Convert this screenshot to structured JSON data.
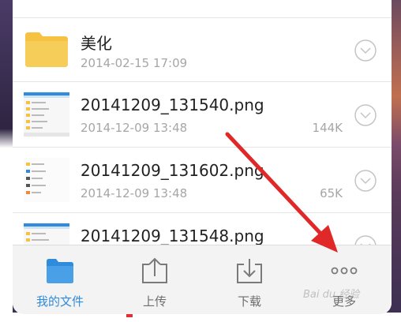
{
  "files": [
    {
      "name": "美化",
      "date": "2014-02-15 17:09",
      "size": "",
      "kind": "folder",
      "icon": "folder-icon"
    },
    {
      "name": "20141209_131540.png",
      "date": "2014-12-09 13:48",
      "size": "144K",
      "kind": "image",
      "icon": "image-thumbnail"
    },
    {
      "name": "20141209_131602.png",
      "date": "2014-12-09 13:48",
      "size": "65K",
      "kind": "image",
      "icon": "image-thumbnail"
    },
    {
      "name": "20141209_131548.png",
      "date": "",
      "size": "",
      "kind": "image",
      "icon": "image-thumbnail"
    }
  ],
  "tabbar": {
    "tabs": [
      {
        "label": "我的文件",
        "icon": "folder-icon",
        "active": true
      },
      {
        "label": "上传",
        "icon": "upload-icon",
        "active": false
      },
      {
        "label": "下载",
        "icon": "download-icon",
        "active": false
      },
      {
        "label": "更多",
        "icon": "more-icon",
        "active": false
      }
    ]
  },
  "watermark": "Bai du 经验",
  "colors": {
    "accent": "#2f8bdc",
    "folder": "#f5c242",
    "annotation_arrow": "#e02828"
  }
}
